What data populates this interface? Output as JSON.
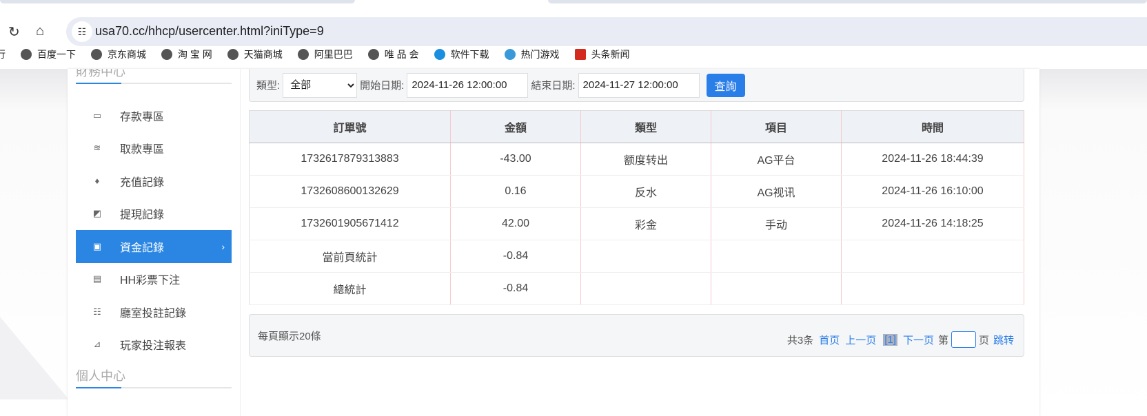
{
  "browser": {
    "url": "usa70.cc/hhcp/usercenter.html?iniType=9",
    "bookmarks": [
      "百度一下",
      "京东商城",
      "淘 宝 网",
      "天猫商城",
      "阿里巴巴",
      "唯 品 会",
      "软件下载",
      "热门游戏",
      "头条新闻"
    ],
    "bookmark_fragment": "行"
  },
  "sidebar": {
    "section1": "財務中心",
    "section2": "個人中心",
    "items": [
      {
        "label": "存款專區",
        "icon": "card-icon"
      },
      {
        "label": "取款專區",
        "icon": "hand-money-icon"
      },
      {
        "label": "充值記錄",
        "icon": "money-bag-icon"
      },
      {
        "label": "提現記錄",
        "icon": "wallet-icon"
      },
      {
        "label": "資金記錄",
        "icon": "funds-icon",
        "active": true
      },
      {
        "label": "HH彩票下注",
        "icon": "ticket-icon"
      },
      {
        "label": "廳室投註記錄",
        "icon": "list-icon"
      },
      {
        "label": "玩家投注報表",
        "icon": "chart-icon"
      }
    ]
  },
  "filter": {
    "type_label": "類型:",
    "type_value": "全部",
    "start_label": "開始日期:",
    "start_value": "2024-11-26 12:00:00",
    "end_label": "結束日期:",
    "end_value": "2024-11-27 12:00:00",
    "query": "查詢"
  },
  "table": {
    "headers": [
      "訂單號",
      "金額",
      "類型",
      "項目",
      "時間"
    ],
    "rows": [
      [
        "1732617879313883",
        "-43.00",
        "额度转出",
        "AG平台",
        "2024-11-26 18:44:39"
      ],
      [
        "1732608600132629",
        "0.16",
        "反水",
        "AG视讯",
        "2024-11-26 16:10:00"
      ],
      [
        "1732601905671412",
        "42.00",
        "彩金",
        "手动",
        "2024-11-26 14:18:25"
      ]
    ],
    "page_total_label": "當前頁統計",
    "page_total": "-0.84",
    "grand_total_label": "總統計",
    "grand_total": "-0.84"
  },
  "pager": {
    "per_page": "每頁顯示20條",
    "total": "共3条",
    "first": "首页",
    "prev": "上一页",
    "current": "[1]",
    "next": "下一页",
    "goto_prefix": "第",
    "goto_suffix": "页",
    "jump": "跳转"
  },
  "colors": {
    "accent": "#2a86e2"
  }
}
